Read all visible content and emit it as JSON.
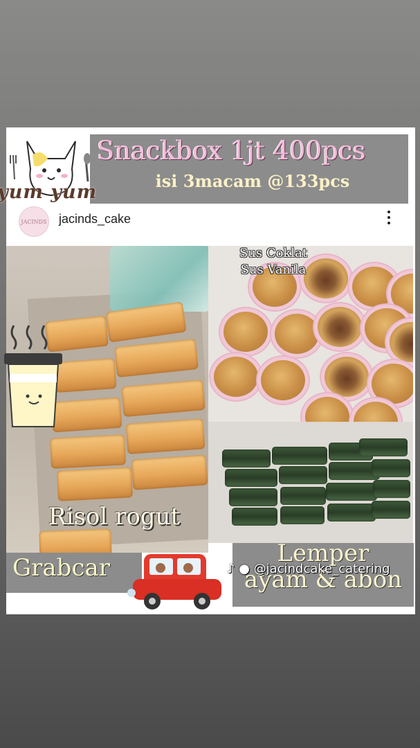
{
  "header": {
    "title": "Snackbox 1jt 400pcs",
    "subtitle": "isi 3macam @133pcs",
    "sticker_text": "yum yum"
  },
  "profile": {
    "username": "jacinds_cake",
    "avatar_text": "JACINDS",
    "more_icon": "more-vert-icon"
  },
  "photos": {
    "risol_caption": "Risol rogut",
    "sus_caption": "Sus Coklat\nSus Vanila",
    "lemper_caption": "Lemper\nayam & abon"
  },
  "footer": {
    "delivery_label": "Grabcar",
    "tiktok_handle": "@jacindcake_catering"
  },
  "colors": {
    "title_pink": "#f3b9d8",
    "cream_text": "#fbf1c7",
    "label_box_gray": "#8c8c8c"
  }
}
